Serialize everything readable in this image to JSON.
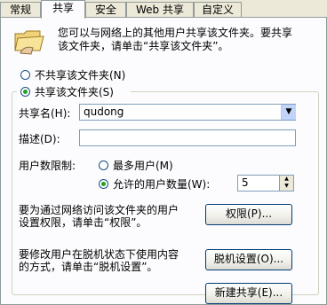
{
  "tabs": [
    "常规",
    "共享",
    "安全",
    "Web 共享",
    "自定义"
  ],
  "description": "您可以与网络上的其他用户共享该文件夹。要共享该文件夹，请单击“共享该文件夹”。",
  "description_lines": [
    "您可以与网络上的其他用户共享该文件夹。要共享",
    "该文件夹，请单击“共享该文件夹”。"
  ],
  "option_no_share": "不共享该文件夹(N)",
  "option_share": "共享该文件夹(S)",
  "share_name_label": "共享名(H):",
  "share_name_value": "qudong",
  "description_label": "描述(D):",
  "description_value": "",
  "user_limit_label": "用户数限制:",
  "max_users_label": "最多用户(M)",
  "allowed_users_label": "允许的用户数量(W):",
  "allowed_users_value": "5",
  "permissions_text_lines": [
    "要为通过网络访问该文件夹的用户",
    "设置权限，请单击“权限”。"
  ],
  "permissions_button": "权限(P)...",
  "offline_text_lines": [
    "要修改用户在脱机状态下使用内容",
    "的方式，请单击“脱机设置”。"
  ],
  "offline_button": "脱机设置(O)...",
  "new_share_button": "新建共享(E)...",
  "selected_option": "share",
  "selected_limit": "allowed"
}
